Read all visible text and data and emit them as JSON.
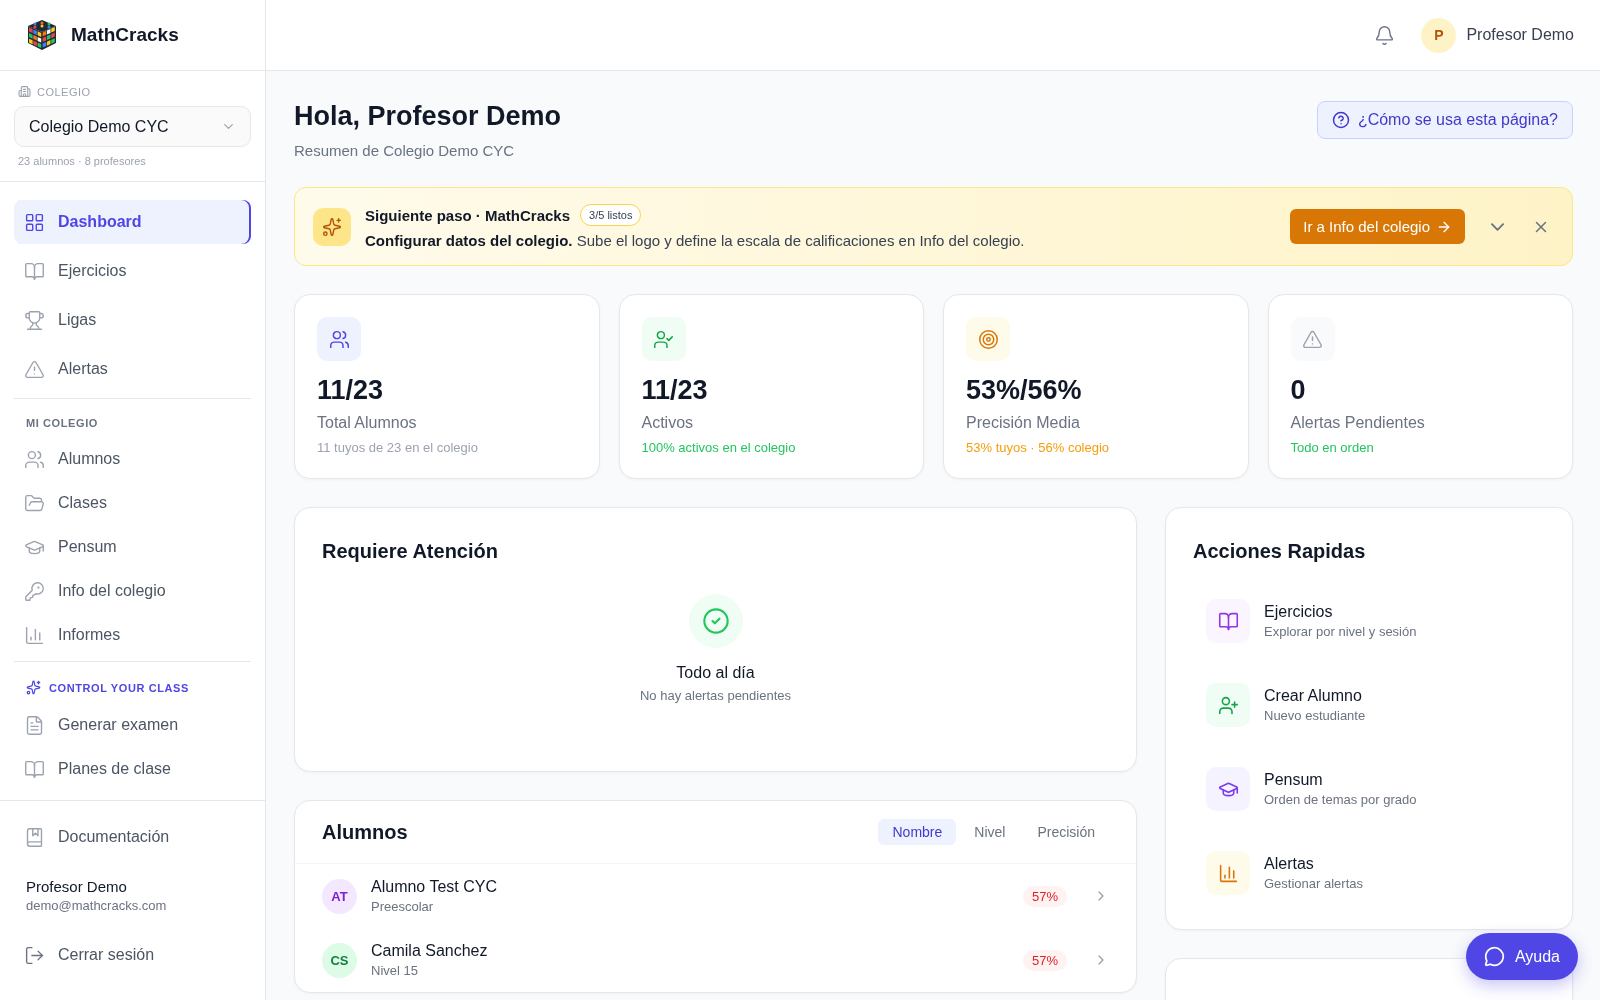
{
  "brand": {
    "name": "MathCracks"
  },
  "school": {
    "label": "COLEGIO",
    "name": "Colegio Demo CYC",
    "meta": "23 alumnos · 8 profesores"
  },
  "nav": [
    {
      "label": "Dashboard",
      "selected": true
    },
    {
      "label": "Ejercicios",
      "selected": false
    },
    {
      "label": "Ligas",
      "selected": false
    },
    {
      "label": "Alertas",
      "selected": false
    }
  ],
  "my_school": {
    "title": "MI COLEGIO",
    "items": [
      {
        "label": "Alumnos",
        "selected": false
      },
      {
        "label": "Clases",
        "selected": false
      },
      {
        "label": "Pensum",
        "selected": false
      },
      {
        "label": "Info del colegio",
        "selected": false
      },
      {
        "label": "Informes",
        "selected": false
      }
    ]
  },
  "control": {
    "title": "CONTROL YOUR CLASS",
    "items": [
      {
        "label": "Generar examen",
        "selected": false
      },
      {
        "label": "Planes de clase",
        "selected": false
      }
    ]
  },
  "sidebar_footer": {
    "docs": "Documentación",
    "user_name": "Profesor Demo",
    "user_email": "demo@mathcracks.com",
    "logout": "Cerrar sesión"
  },
  "header": {
    "initial": "P",
    "user_name": "Profesor Demo"
  },
  "greeting": {
    "title": "Hola, Profesor Demo",
    "subtitle": "Resumen de Colegio Demo CYC",
    "help": "¿Cómo se usa esta página?"
  },
  "banner": {
    "title": "Siguiente paso · MathCracks",
    "badge": "3/5 listos",
    "text": "**Configurar datos del colegio.** Sube el logo y define la escala de calificaciones en Info del colegio.",
    "button": "Ir a Info del colegio"
  },
  "stats": [
    {
      "value": "11/23",
      "label": "Total Alumnos",
      "note": "11 tuyos de 23 en el colegio"
    },
    {
      "value": "11/23",
      "label": "Activos",
      "note": "100% activos en el colegio"
    },
    {
      "value": "53%/56%",
      "label": "Precisión Media",
      "note": "53% tuyos · 56% colegio"
    },
    {
      "value": "0",
      "label": "Alertas Pendientes",
      "note": "Todo en orden"
    }
  ],
  "attention": {
    "title": "Requiere Atención",
    "status": "Todo al día",
    "note": "No hay alertas pendientes"
  },
  "students": {
    "title": "Alumnos",
    "sorts": [
      {
        "label": "Nombre",
        "selected": true
      },
      {
        "label": "Nivel",
        "selected": false
      },
      {
        "label": "Precisión",
        "selected": false
      }
    ],
    "rows": [
      {
        "initials": "AT",
        "name": "Alumno Test CYC",
        "level": "Preescolar",
        "score": "57%"
      },
      {
        "initials": "CS",
        "name": "Camila Sanchez",
        "level": "Nivel 15",
        "score": "57%"
      }
    ]
  },
  "quick": {
    "title": "Acciones Rapidas",
    "items": [
      {
        "title": "Ejercicios",
        "subtitle": "Explorar por nivel y sesión"
      },
      {
        "title": "Crear Alumno",
        "subtitle": "Nuevo estudiante"
      },
      {
        "title": "Pensum",
        "subtitle": "Orden de temas por grado"
      },
      {
        "title": "Alertas",
        "subtitle": "Gestionar alertas"
      }
    ]
  },
  "help_button": {
    "label": "Ayuda"
  }
}
